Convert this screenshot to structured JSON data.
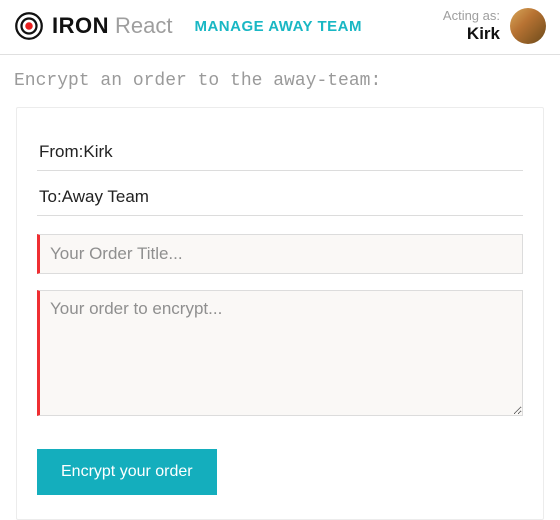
{
  "header": {
    "brand_bold": "IRON",
    "brand_light": "React",
    "manage_link": "MANAGE AWAY TEAM",
    "acting_as_label": "Acting as:",
    "acting_as_name": "Kirk"
  },
  "page": {
    "title": "Encrypt an order to the away-team:"
  },
  "form": {
    "from_label": "From:",
    "from_value": "Kirk",
    "to_label": "To:",
    "to_value": "Away Team",
    "title_placeholder": "Your Order Title...",
    "title_value": "",
    "body_placeholder": "Your order to encrypt...",
    "body_value": "",
    "submit_label": "Encrypt your order"
  },
  "colors": {
    "accent": "#14aebd",
    "danger_border": "#ef2e32"
  }
}
